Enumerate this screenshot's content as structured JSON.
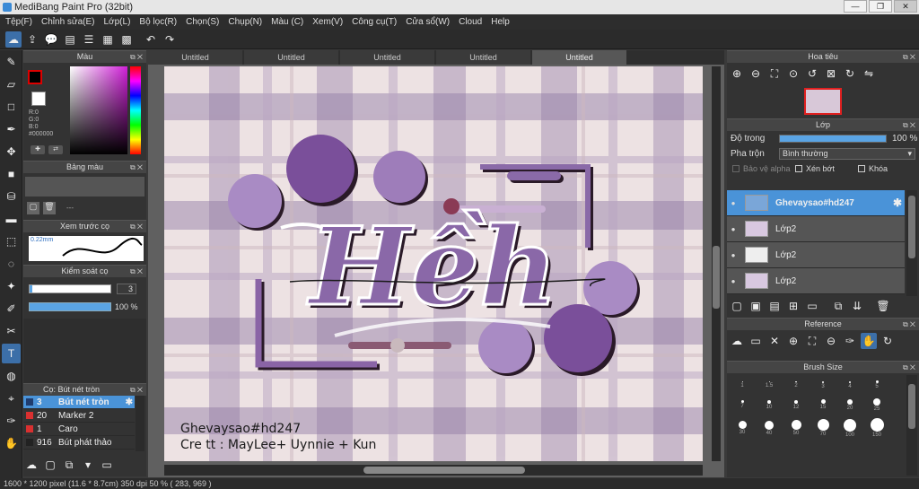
{
  "window": {
    "title": "MediBang Paint Pro (32bit)"
  },
  "menu": [
    "Tệp(F)",
    "Chỉnh sửa(E)",
    "Lớp(L)",
    "Bộ lọc(R)",
    "Chọn(S)",
    "Chụp(N)",
    "Màu (C)",
    "Xem(V)",
    "Công cụ(T)",
    "Cửa sổ(W)",
    "Cloud",
    "Help"
  ],
  "tabs": [
    "Untitled",
    "Untitled",
    "Untitled",
    "Untitled",
    "Untitled"
  ],
  "color_panel": {
    "title": "Màu",
    "r": "R:0",
    "g": "G:0",
    "b": "B:0",
    "hex": "#000000"
  },
  "palette_panel": {
    "title": "Bảng màu",
    "label": "---"
  },
  "brush_preview": {
    "title": "Xem trước cọ",
    "size": "0.22mm"
  },
  "control_panel": {
    "title": "Kiểm soát cọ",
    "size_value": "3",
    "opacity_value": "100 %"
  },
  "brush_list": {
    "title": "Cọ: Bút nét tròn",
    "items": [
      {
        "num": "3",
        "name": "Bút nét tròn",
        "color": "#1f3c6e",
        "selected": true
      },
      {
        "num": "20",
        "name": "Marker 2",
        "color": "#d93030",
        "selected": false
      },
      {
        "num": "1",
        "name": "Caro",
        "color": "#d93030",
        "selected": false
      },
      {
        "num": "916",
        "name": "Bút phát thảo",
        "color": "#222222",
        "selected": false
      }
    ]
  },
  "canvas": {
    "watermark_line1": "Ghevaysao#hd247",
    "watermark_line2": "Cre tt : MayLee+ Uynnie + Kun",
    "art_text": "Hềh"
  },
  "navigator": {
    "title": "Hoa tiêu"
  },
  "layer_panel": {
    "title": "Lớp",
    "opacity_label": "Độ trong",
    "opacity_value": "100 %",
    "opacity_fraction": 1.0,
    "blend_label": "Pha trộn",
    "blend_value": "Bình thường",
    "protect_alpha": "Bảo vệ alpha",
    "clipping": "Xén bớt",
    "lock": "Khóa",
    "layers": [
      {
        "name": "Ghevaysao#hd247",
        "selected": true
      },
      {
        "name": "Lớp2",
        "selected": false
      },
      {
        "name": "Lớp2",
        "selected": false
      },
      {
        "name": "Lớp2",
        "selected": false
      }
    ]
  },
  "reference_panel": {
    "title": "Reference"
  },
  "brush_size_panel": {
    "title": "Brush Size",
    "sizes": [
      "1",
      "1.5",
      "2",
      "3",
      "4",
      "5",
      "7",
      "10",
      "12",
      "15",
      "20",
      "25",
      "30",
      "40",
      "50",
      "70",
      "100",
      "150"
    ]
  },
  "status": {
    "text": "1600 * 1200 pixel  (11.6 * 8.7cm)  350 dpi  50 %  ( 283, 969 )"
  }
}
